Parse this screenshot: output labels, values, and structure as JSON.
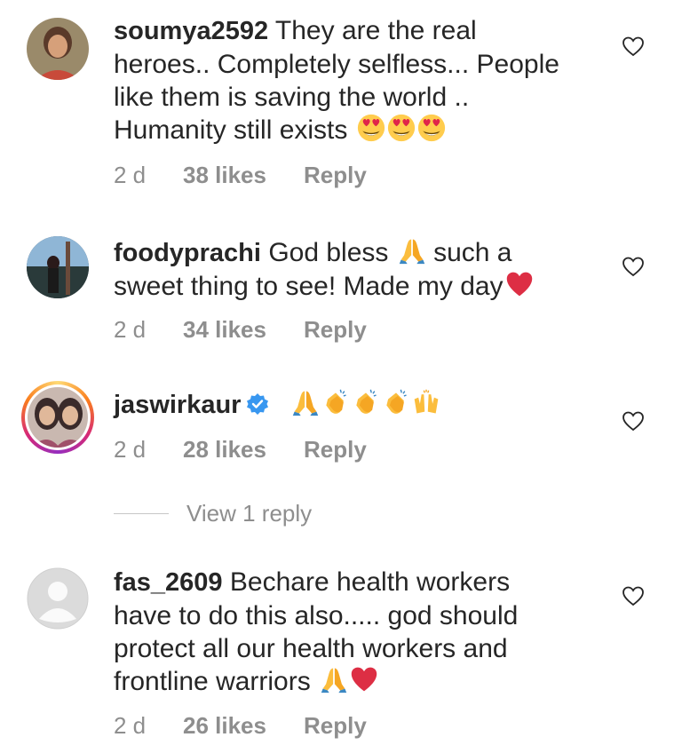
{
  "comments": [
    {
      "username": "soumya2592",
      "text_lines": [
        "They are the real",
        "heroes.. Completely selfless... People",
        "like them is saving the world ..",
        "Humanity still exists"
      ],
      "emojis": [
        "heart-eyes-emoji",
        "heart-eyes-emoji",
        "heart-eyes-emoji"
      ],
      "time": "2 d",
      "likes": "38 likes",
      "reply": "Reply"
    },
    {
      "username": "foodyprachi",
      "text_line1": "God bless",
      "text_line1b": "such a",
      "text_line2": "sweet thing to see! Made my day",
      "emojis": [
        "folded-hands-emoji",
        "red-heart-emoji"
      ],
      "time": "2 d",
      "likes": "34 likes",
      "reply": "Reply"
    },
    {
      "username": "jaswirkaur",
      "verified": true,
      "emojis": [
        "folded-hands-emoji",
        "clapping-hands-emoji",
        "clapping-hands-emoji",
        "clapping-hands-emoji",
        "raising-hands-emoji"
      ],
      "time": "2 d",
      "likes": "28 likes",
      "reply": "Reply",
      "view_replies": "View 1 reply"
    },
    {
      "username": "fas_2609",
      "text_lines": [
        "Bechare health workers",
        "have to do this also..... god should",
        "protect all our health workers and",
        "frontline warriors"
      ],
      "emojis": [
        "folded-hands-emoji",
        "red-heart-emoji"
      ],
      "time": "2 d",
      "likes": "26 likes",
      "reply": "Reply"
    }
  ],
  "colors": {
    "text": "#262626",
    "meta": "#8e8e8e",
    "verified": "#3897f0",
    "heart": "#e0244a"
  },
  "icons": {
    "like": "heart-outline-icon",
    "verified": "verified-badge-icon",
    "default_avatar": "default-avatar-icon"
  }
}
